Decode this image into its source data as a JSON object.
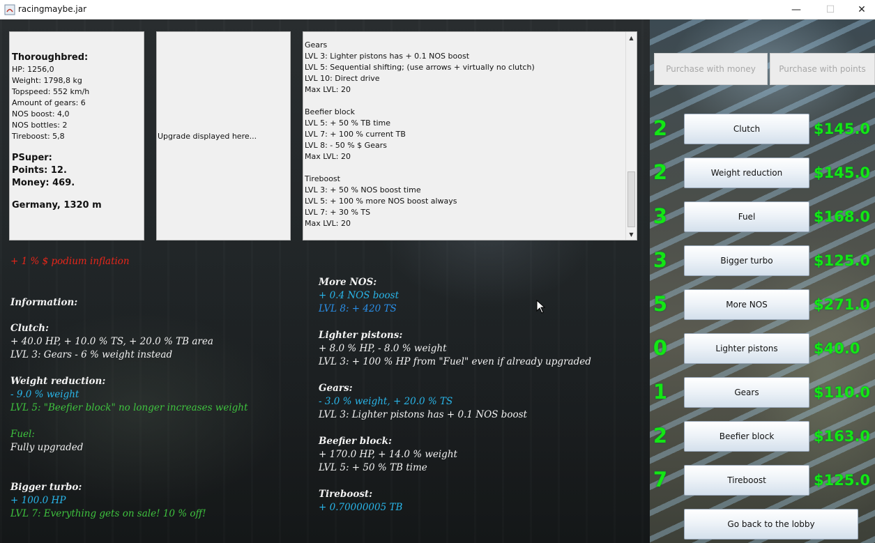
{
  "window": {
    "title": "racingmaybe.jar",
    "minimize_glyph": "—",
    "maximize_glyph": "☐",
    "close_glyph": "✕"
  },
  "car": {
    "name": "Thoroughbred:",
    "stats": [
      "HP: 1256,0",
      "Weight: 1798,8 kg",
      "Topspeed: 552 km/h",
      "Amount of gears: 6",
      "NOS boost: 4,0",
      "NOS bottles: 2",
      "Tireboost: 5,8"
    ],
    "player": "PSuper:",
    "points": "Points: 12.",
    "money": "Money: 469.",
    "track": "Germany, 1320 m"
  },
  "upgrade_panel": {
    "text": "Upgrade displayed here..."
  },
  "info_panel": {
    "lines": [
      "Gears",
      "LVL 3: Lighter pistons has + 0.1 NOS boost",
      "LVL 5: Sequential shifting; (use arrows + virtually no clutch)",
      "LVL 10: Direct drive",
      "Max LVL: 20",
      "",
      "Beefier block",
      "LVL 5: + 50 % TB time",
      "LVL 7: + 100 % current TB",
      "LVL 8: - 50 % $ Gears",
      "Max LVL: 20",
      "",
      "Tireboost",
      "LVL 3: + 50 % NOS boost time",
      "LVL 5: + 100 % more NOS boost always",
      "LVL 7: + 30 % TS",
      "Max LVL: 20"
    ]
  },
  "inflation": "+ 1 % $ podium inflation",
  "information_title": "Information:",
  "left_info": {
    "clutch_title": "Clutch:",
    "clutch_l1": "+ 40.0 HP, + 10.0 % TS, + 20.0 % TB area",
    "clutch_l2": "LVL 3: Gears - 6 % weight instead",
    "weight_title": "Weight reduction:",
    "weight_l1": "- 9.0 % weight",
    "weight_l2": "LVL 5: \"Beefier block\" no longer increases weight",
    "fuel_title": "Fuel:",
    "fuel_l1": "Fully upgraded",
    "turbo_title": "Bigger turbo:",
    "turbo_l1": "+ 100.0 HP",
    "turbo_l2": "LVL 7: Everything gets on sale! 10 % off!"
  },
  "mid_info": {
    "nos_title": "More NOS:",
    "nos_l1": "+ 0.4 NOS boost",
    "nos_l2": "LVL 8: + 420 TS",
    "pistons_title": "Lighter pistons:",
    "pistons_l1": "+ 8.0 % HP, - 8.0 % weight",
    "pistons_l2": "LVL 3: + 100 % HP from \"Fuel\" even if already upgraded",
    "gears_title": "Gears:",
    "gears_l1": "- 3.0 % weight, + 20.0 % TS",
    "gears_l2": "LVL 3: Lighter pistons has + 0.1 NOS boost",
    "block_title": "Beefier block:",
    "block_l1": "+ 170.0 HP, + 14.0 % weight",
    "block_l2": "LVL 5: + 50 % TB time",
    "tire_title": "Tireboost:",
    "tire_l1": "+ 0.70000005 TB"
  },
  "purchase": {
    "money_label": "Purchase with money",
    "points_label": "Purchase with points"
  },
  "upgrades": [
    {
      "level": "2",
      "name": "Clutch",
      "price": "$145.0"
    },
    {
      "level": "2",
      "name": "Weight reduction",
      "price": "$145.0"
    },
    {
      "level": "3",
      "name": "Fuel",
      "price": "$168.0"
    },
    {
      "level": "3",
      "name": "Bigger turbo",
      "price": "$125.0"
    },
    {
      "level": "5",
      "name": "More NOS",
      "price": "$271.0"
    },
    {
      "level": "0",
      "name": "Lighter pistons",
      "price": "$40.0"
    },
    {
      "level": "1",
      "name": "Gears",
      "price": "$110.0"
    },
    {
      "level": "2",
      "name": "Beefier block",
      "price": "$163.0"
    },
    {
      "level": "7",
      "name": "Tireboost",
      "price": "$125.0"
    }
  ],
  "lobby_label": "Go back to the lobby",
  "colors": {
    "level_green": "#14e614",
    "info_cyan": "#29b6ea",
    "info_green": "#3fc33f",
    "inflation_red": "#e8261a"
  }
}
